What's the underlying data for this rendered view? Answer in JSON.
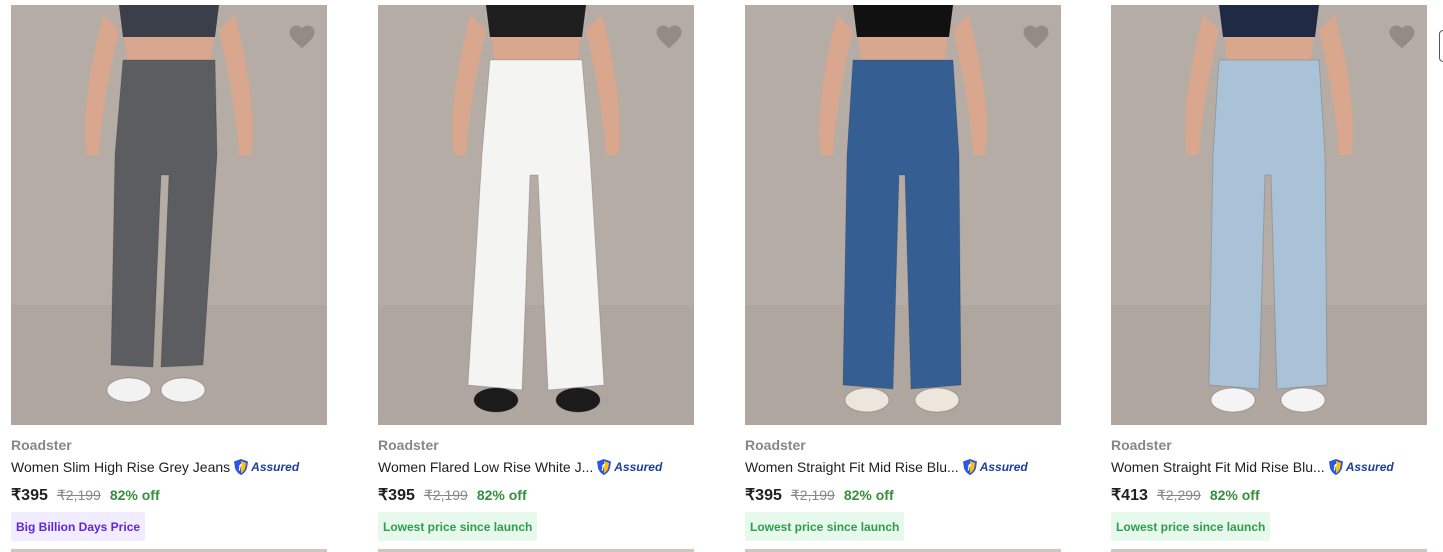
{
  "products": [
    {
      "brand": "Roadster",
      "title": "Women Slim High Rise Grey Jeans",
      "assured_label": "Assured",
      "price": "₹395",
      "mrp": "₹2,199",
      "discount": "82% off",
      "badge": "Big Billion Days Price",
      "badge_style": "purple",
      "jeans_color": "#5c5d61",
      "top_color": "#3b3f4a",
      "shoe_color": "#f2f2f2",
      "style": "slim"
    },
    {
      "brand": "Roadster",
      "title": "Women Flared Low Rise White J...",
      "assured_label": "Assured",
      "price": "₹395",
      "mrp": "₹2,199",
      "discount": "82% off",
      "badge": "Lowest price since launch",
      "badge_style": "green",
      "jeans_color": "#f4f4f2",
      "top_color": "#1e1e1e",
      "shoe_color": "#1b1b1b",
      "style": "flared"
    },
    {
      "brand": "Roadster",
      "title": "Women Straight Fit Mid Rise Blu...",
      "assured_label": "Assured",
      "price": "₹395",
      "mrp": "₹2,199",
      "discount": "82% off",
      "badge": "Lowest price since launch",
      "badge_style": "green",
      "jeans_color": "#355f93",
      "top_color": "#111111",
      "shoe_color": "#ece6dd",
      "style": "straight"
    },
    {
      "brand": "Roadster",
      "title": "Women Straight Fit Mid Rise Blu...",
      "assured_label": "Assured",
      "price": "₹413",
      "mrp": "₹2,299",
      "discount": "82% off",
      "badge": "Lowest price since launch",
      "badge_style": "green",
      "jeans_color": "#a9c2d8",
      "top_color": "#1f2a44",
      "shoe_color": "#f4f4f4",
      "style": "straight"
    }
  ],
  "icons": {
    "wishlist": "heart-icon",
    "assured": "assured-shield-icon"
  }
}
